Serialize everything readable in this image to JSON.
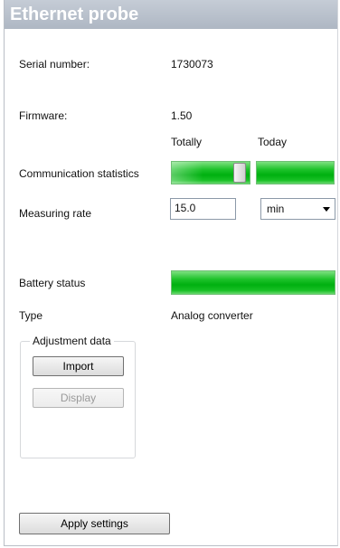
{
  "header": {
    "title": "Ethernet probe"
  },
  "fields": {
    "serial_label": "Serial number:",
    "serial_value": "1730073",
    "firmware_label": "Firmware:",
    "firmware_value": "1.50",
    "col_totally": "Totally",
    "col_today": "Today",
    "comm_label": "Communication statistics",
    "rate_label": "Measuring rate",
    "rate_value": "15.0",
    "rate_unit": "min",
    "battery_label": "Battery status",
    "type_label": "Type",
    "type_value": "Analog converter"
  },
  "adjustment": {
    "title": "Adjustment data",
    "import_label": "Import",
    "display_label": "Display"
  },
  "footer": {
    "apply_label": "Apply settings"
  },
  "colors": {
    "header": "#aeb7c3",
    "bar_green": "#00b010"
  }
}
